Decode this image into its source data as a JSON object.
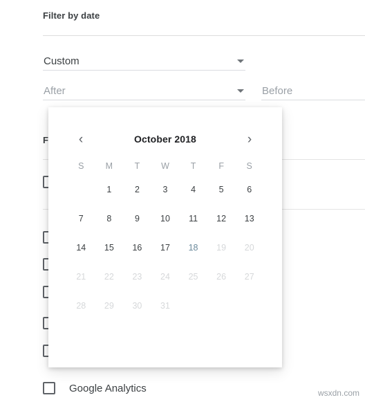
{
  "form": {
    "section_title": "Filter by date",
    "second_heading": "F",
    "range_select": {
      "value": "Custom",
      "caret_icon": "chevron-down-icon"
    },
    "after_field": {
      "placeholder": "After",
      "value": "",
      "caret_icon": "chevron-down-icon"
    },
    "before_field": {
      "placeholder": "Before",
      "value": ""
    },
    "checkboxes": [
      {
        "label": "",
        "checked": false
      },
      {
        "label": "",
        "checked": false
      },
      {
        "label": "",
        "checked": false
      },
      {
        "label": "",
        "checked": false
      },
      {
        "label": "",
        "checked": false
      },
      {
        "label": "",
        "checked": false
      },
      {
        "label": "Google Analytics",
        "checked": false
      }
    ]
  },
  "calendar": {
    "title": "October 2018",
    "prev_icon": "‹",
    "next_icon": "›",
    "weekdays": [
      "S",
      "M",
      "T",
      "W",
      "T",
      "F",
      "S"
    ],
    "leading_blanks": 1,
    "days": [
      {
        "n": "1",
        "state": "enabled"
      },
      {
        "n": "2",
        "state": "enabled"
      },
      {
        "n": "3",
        "state": "enabled"
      },
      {
        "n": "4",
        "state": "enabled"
      },
      {
        "n": "5",
        "state": "enabled"
      },
      {
        "n": "6",
        "state": "enabled"
      },
      {
        "n": "7",
        "state": "enabled"
      },
      {
        "n": "8",
        "state": "enabled"
      },
      {
        "n": "9",
        "state": "enabled"
      },
      {
        "n": "10",
        "state": "enabled"
      },
      {
        "n": "11",
        "state": "enabled"
      },
      {
        "n": "12",
        "state": "enabled"
      },
      {
        "n": "13",
        "state": "enabled"
      },
      {
        "n": "14",
        "state": "enabled"
      },
      {
        "n": "15",
        "state": "enabled"
      },
      {
        "n": "16",
        "state": "enabled"
      },
      {
        "n": "17",
        "state": "enabled"
      },
      {
        "n": "18",
        "state": "today"
      },
      {
        "n": "19",
        "state": "disabled"
      },
      {
        "n": "20",
        "state": "disabled"
      },
      {
        "n": "21",
        "state": "disabled"
      },
      {
        "n": "22",
        "state": "disabled"
      },
      {
        "n": "23",
        "state": "disabled"
      },
      {
        "n": "24",
        "state": "disabled"
      },
      {
        "n": "25",
        "state": "disabled"
      },
      {
        "n": "26",
        "state": "disabled"
      },
      {
        "n": "27",
        "state": "disabled"
      },
      {
        "n": "28",
        "state": "disabled"
      },
      {
        "n": "29",
        "state": "disabled"
      },
      {
        "n": "30",
        "state": "disabled"
      },
      {
        "n": "31",
        "state": "disabled"
      }
    ]
  },
  "watermark": "wsxdn.com",
  "colors": {
    "text": "#3c4043",
    "muted": "#9aa0a6",
    "disabled": "#d6d8da",
    "today": "#6b8a9c",
    "rule": "#dadce0"
  }
}
